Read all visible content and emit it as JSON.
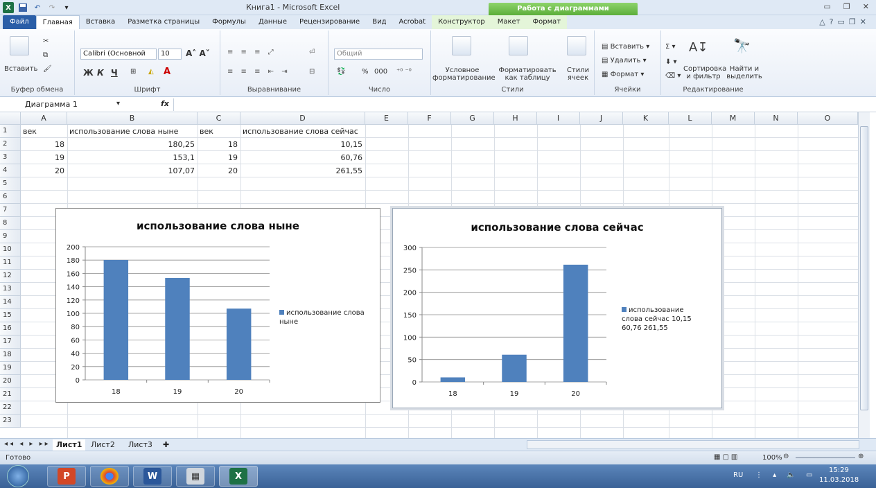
{
  "window": {
    "title": "Книга1 - Microsoft Excel",
    "context_tab": "Работа с диаграммами"
  },
  "tabs": [
    "Главная",
    "Вставка",
    "Разметка страницы",
    "Формулы",
    "Данные",
    "Рецензирование",
    "Вид",
    "Acrobat",
    "Конструктор",
    "Макет",
    "Формат"
  ],
  "file_tab": "Файл",
  "ribbon": {
    "clipboard": {
      "paste": "Вставить",
      "label": "Буфер обмена"
    },
    "font": {
      "name": "Calibri (Основной",
      "size": "10",
      "bold": "Ж",
      "italic": "К",
      "underline": "Ч",
      "label": "Шрифт"
    },
    "alignment": {
      "label": "Выравнивание"
    },
    "number": {
      "format": "Общий",
      "percent": "%",
      "thousands": "000",
      "label": "Число"
    },
    "styles": {
      "cond": "Условное форматирование",
      "table": "Форматировать как таблицу",
      "cell": "Стили ячеек",
      "label": "Стили"
    },
    "cells": {
      "insert": "Вставить",
      "delete": "Удалить",
      "format": "Формат",
      "label": "Ячейки"
    },
    "editing": {
      "sort": "Сортировка и фильтр",
      "find": "Найти и выделить",
      "label": "Редактирование"
    }
  },
  "formula_bar": {
    "name_box": "Диаграмма 1",
    "fx": "fx",
    "formula": ""
  },
  "columns": [
    "A",
    "B",
    "C",
    "D",
    "E",
    "F",
    "G",
    "H",
    "I",
    "J",
    "K",
    "L",
    "M",
    "N",
    "O"
  ],
  "rows": [
    "1",
    "2",
    "3",
    "4",
    "5",
    "6",
    "7",
    "8",
    "9",
    "10",
    "11",
    "12",
    "13",
    "14",
    "15",
    "16",
    "17",
    "18",
    "19",
    "20",
    "21",
    "22",
    "23"
  ],
  "cells": {
    "A1": "век",
    "B1": "использование слова ныне",
    "C1": "век",
    "D1": "использование слова сейчас",
    "A2": "18",
    "B2": "180,25",
    "C2": "18",
    "D2": "10,15",
    "A3": "19",
    "B3": "153,1",
    "C3": "19",
    "D3": "60,76",
    "A4": "20",
    "B4": "107,07",
    "C4": "20",
    "D4": "261,55"
  },
  "chart_data": [
    {
      "type": "bar",
      "title": "использование слова ныне",
      "categories": [
        "18",
        "19",
        "20"
      ],
      "series": [
        {
          "name": "использование слова ныне",
          "values": [
            180.25,
            153.1,
            107.07
          ]
        }
      ],
      "ylim": [
        0,
        200
      ],
      "yticks": [
        "0",
        "20",
        "40",
        "60",
        "80",
        "100",
        "120",
        "140",
        "160",
        "180",
        "200"
      ],
      "grid": true,
      "legend": "right",
      "color": "#4f81bd"
    },
    {
      "type": "bar",
      "title": "использование слова сейчас",
      "categories": [
        "18",
        "19",
        "20"
      ],
      "series": [
        {
          "name": "использование слова сейчас 10,15 60,76 261,55",
          "values": [
            10.15,
            60.76,
            261.55
          ]
        }
      ],
      "ylim": [
        0,
        300
      ],
      "yticks": [
        "0",
        "50",
        "100",
        "150",
        "200",
        "250",
        "300"
      ],
      "grid": true,
      "legend": "right",
      "color": "#4f81bd"
    }
  ],
  "sheets": [
    "Лист1",
    "Лист2",
    "Лист3"
  ],
  "status": {
    "ready": "Готово",
    "zoom": "100%"
  },
  "tray": {
    "lang": "RU",
    "time": "15:29",
    "date": "11.03.2018"
  }
}
